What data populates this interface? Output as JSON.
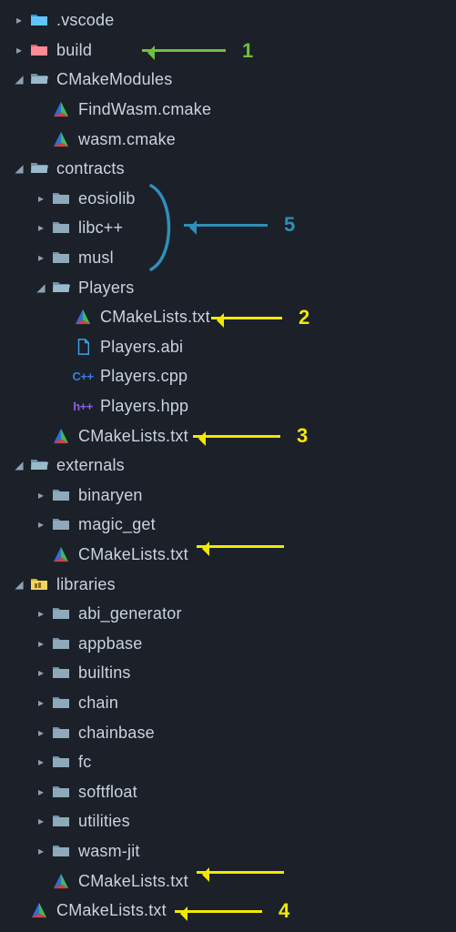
{
  "tree": [
    {
      "depth": 0,
      "arrow": "right",
      "icon": "vscode-folder",
      "label": ".vscode"
    },
    {
      "depth": 0,
      "arrow": "right",
      "icon": "build-folder",
      "label": "build"
    },
    {
      "depth": 0,
      "arrow": "down",
      "icon": "folder-open",
      "label": "CMakeModules"
    },
    {
      "depth": 1,
      "arrow": "",
      "icon": "cmake",
      "label": "FindWasm.cmake"
    },
    {
      "depth": 1,
      "arrow": "",
      "icon": "cmake",
      "label": "wasm.cmake"
    },
    {
      "depth": 0,
      "arrow": "down",
      "icon": "folder-open",
      "label": "contracts"
    },
    {
      "depth": 1,
      "arrow": "right",
      "icon": "folder",
      "label": "eosiolib"
    },
    {
      "depth": 1,
      "arrow": "right",
      "icon": "folder",
      "label": "libc++"
    },
    {
      "depth": 1,
      "arrow": "right",
      "icon": "folder",
      "label": "musl"
    },
    {
      "depth": 1,
      "arrow": "down",
      "icon": "folder-open",
      "label": "Players"
    },
    {
      "depth": 2,
      "arrow": "",
      "icon": "cmake",
      "label": "CMakeLists.txt"
    },
    {
      "depth": 2,
      "arrow": "",
      "icon": "abi",
      "label": "Players.abi"
    },
    {
      "depth": 2,
      "arrow": "",
      "icon": "cpp",
      "label": "Players.cpp"
    },
    {
      "depth": 2,
      "arrow": "",
      "icon": "hpp",
      "label": "Players.hpp"
    },
    {
      "depth": 1,
      "arrow": "",
      "icon": "cmake",
      "label": "CMakeLists.txt"
    },
    {
      "depth": 0,
      "arrow": "down",
      "icon": "folder-open",
      "label": "externals"
    },
    {
      "depth": 1,
      "arrow": "right",
      "icon": "folder",
      "label": "binaryen"
    },
    {
      "depth": 1,
      "arrow": "right",
      "icon": "folder",
      "label": "magic_get"
    },
    {
      "depth": 1,
      "arrow": "",
      "icon": "cmake",
      "label": "CMakeLists.txt"
    },
    {
      "depth": 0,
      "arrow": "down",
      "icon": "lib-folder",
      "label": "libraries"
    },
    {
      "depth": 1,
      "arrow": "right",
      "icon": "folder",
      "label": "abi_generator"
    },
    {
      "depth": 1,
      "arrow": "right",
      "icon": "folder",
      "label": "appbase"
    },
    {
      "depth": 1,
      "arrow": "right",
      "icon": "folder",
      "label": "builtins"
    },
    {
      "depth": 1,
      "arrow": "right",
      "icon": "folder",
      "label": "chain"
    },
    {
      "depth": 1,
      "arrow": "right",
      "icon": "folder",
      "label": "chainbase"
    },
    {
      "depth": 1,
      "arrow": "right",
      "icon": "folder",
      "label": "fc"
    },
    {
      "depth": 1,
      "arrow": "right",
      "icon": "folder",
      "label": "softfloat"
    },
    {
      "depth": 1,
      "arrow": "right",
      "icon": "folder",
      "label": "utilities"
    },
    {
      "depth": 1,
      "arrow": "right",
      "icon": "folder",
      "label": "wasm-jit"
    },
    {
      "depth": 1,
      "arrow": "",
      "icon": "cmake",
      "label": "CMakeLists.txt"
    },
    {
      "depth": 0,
      "arrow": "",
      "icon": "cmake",
      "label": "CMakeLists.txt"
    }
  ],
  "annotations": {
    "a1": {
      "num": "1",
      "color": "#6fbf3f"
    },
    "a2": {
      "num": "2",
      "color": "#f2e900"
    },
    "a3": {
      "num": "3",
      "color": "#f2e900"
    },
    "a4": {
      "num": "4",
      "color": "#f2e900"
    },
    "a5": {
      "num": "5",
      "color": "#2f8fb8"
    }
  }
}
